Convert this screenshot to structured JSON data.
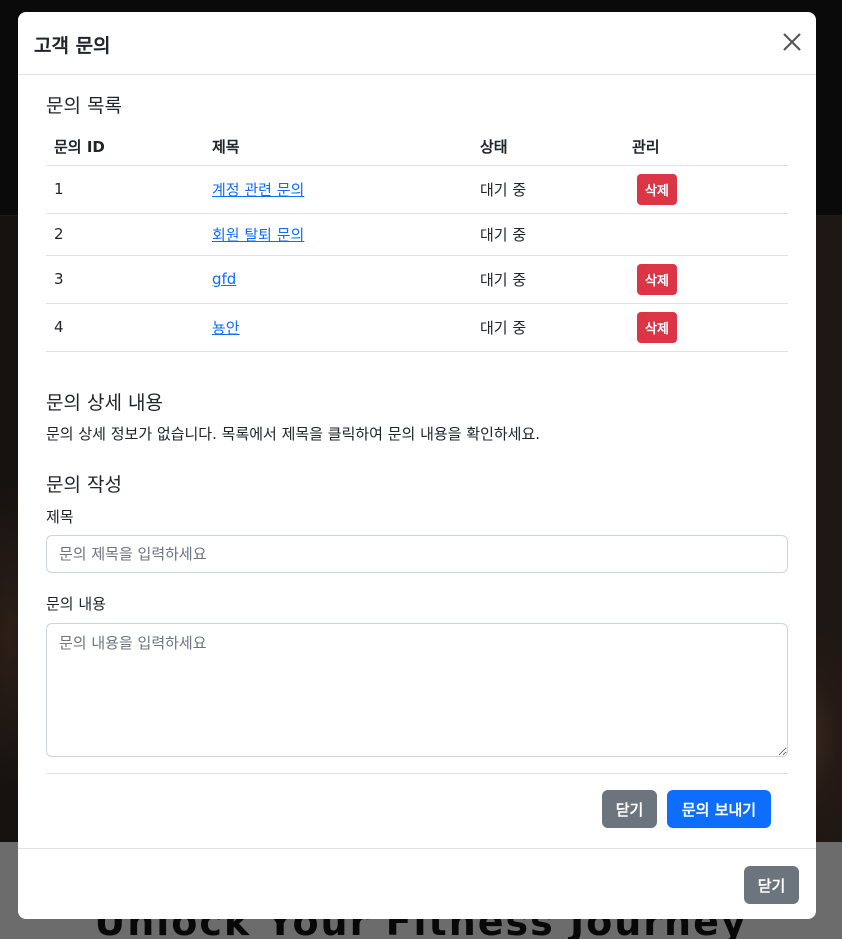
{
  "background": {
    "hero_heading": "Unlock Your Fitness Journey"
  },
  "modal": {
    "title": "고객 문의",
    "close_icon": "close-icon"
  },
  "inquiry_list": {
    "section_title": "문의 목록",
    "columns": [
      "문의 ID",
      "제목",
      "상태",
      "관리"
    ],
    "rows": [
      {
        "id": "1",
        "title": "계정 관련 문의",
        "status": "대기 중",
        "action": "삭제"
      },
      {
        "id": "2",
        "title": "회원 탈퇴 문의",
        "status": "대기 중",
        "action": ""
      },
      {
        "id": "3",
        "title": "gfd",
        "status": "대기 중",
        "action": "삭제"
      },
      {
        "id": "4",
        "title": "뇽안",
        "status": "대기 중",
        "action": "삭제"
      }
    ]
  },
  "detail": {
    "section_title": "문의 상세 내용",
    "empty_text": "문의 상세 정보가 없습니다. 목록에서 제목을 클릭하여 문의 내용을 확인하세요."
  },
  "form": {
    "section_title": "문의 작성",
    "title_label": "제목",
    "title_placeholder": "문의 제목을 입력하세요",
    "content_label": "문의 내용",
    "content_placeholder": "문의 내용을 입력하세요",
    "close_label": "닫기",
    "send_label": "문의 보내기"
  },
  "footer": {
    "close_label": "닫기"
  },
  "colors": {
    "primary": "#0d6efd",
    "secondary": "#6c757d",
    "danger": "#dc3545"
  }
}
